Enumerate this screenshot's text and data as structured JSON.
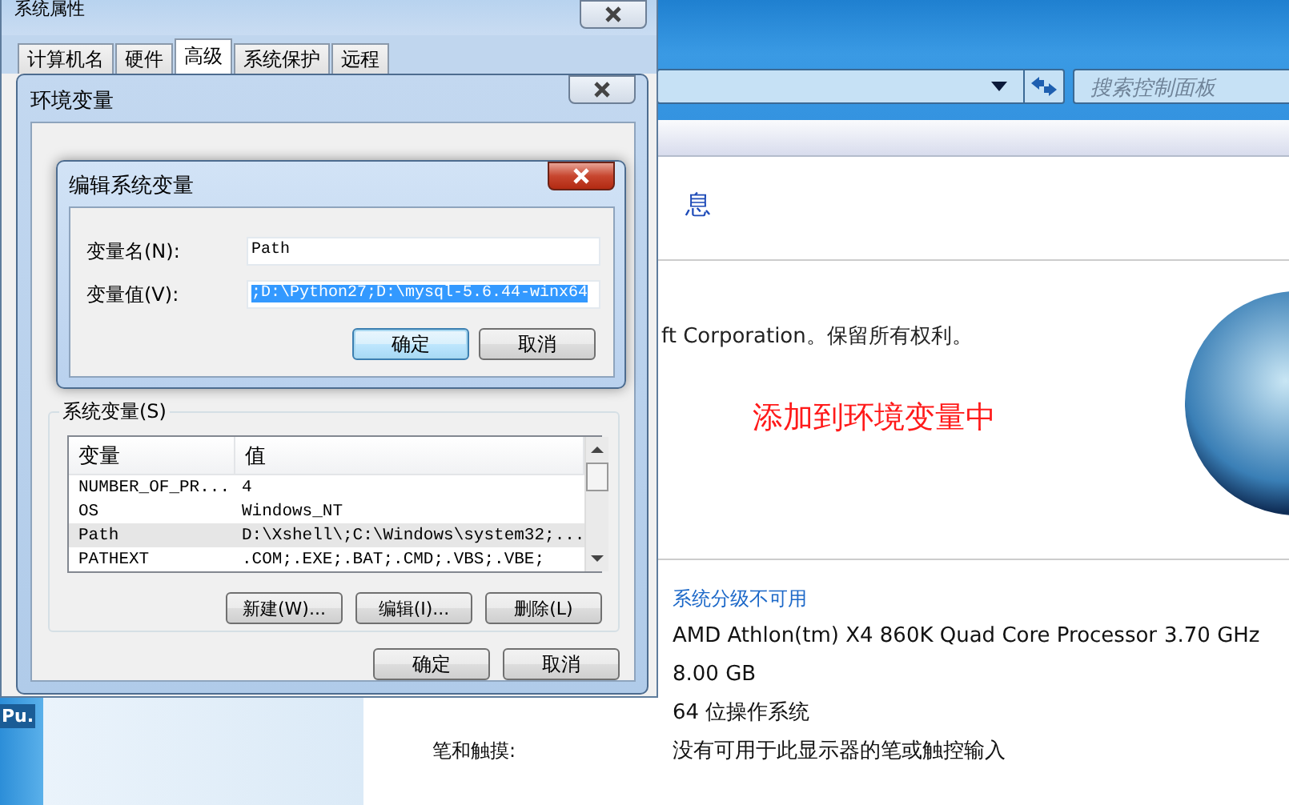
{
  "control_panel": {
    "search": {
      "placeholder": "搜索控制面板"
    },
    "heading": "息",
    "copyright": "ft Corporation。保留所有权利。",
    "annotation": "添加到环境变量中",
    "rating_link": "系统分级不可用",
    "details": [
      {
        "value": "AMD Athlon(tm) X4 860K Quad Core Processor",
        "extra": "3.70 GHz"
      },
      {
        "value": "8.00 GB"
      },
      {
        "value": "64 位操作系统"
      },
      {
        "label": "笔和触摸:",
        "value": "没有可用于此显示器的笔或触控输入"
      }
    ]
  },
  "taskbar_item": "Pu.",
  "system_properties": {
    "title": "系统属性",
    "tabs": [
      {
        "label": "计算机名",
        "selected": false
      },
      {
        "label": "硬件",
        "selected": false
      },
      {
        "label": "高级",
        "selected": true
      },
      {
        "label": "系统保护",
        "selected": false
      },
      {
        "label": "远程",
        "selected": false
      }
    ]
  },
  "environment_dialog": {
    "title": "环境变量",
    "group_label": "系统变量(S)",
    "columns": [
      "变量",
      "值"
    ],
    "rows": [
      {
        "name": "NUMBER_OF_PR...",
        "value": "4",
        "selected": false
      },
      {
        "name": "OS",
        "value": "Windows_NT",
        "selected": false
      },
      {
        "name": "Path",
        "value": "D:\\Xshell\\;C:\\Windows\\system32;...",
        "selected": true
      },
      {
        "name": "PATHEXT",
        "value": ".COM;.EXE;.BAT;.CMD;.VBS;.VBE;",
        "selected": false
      }
    ],
    "row_buttons": [
      "新建(W)...",
      "编辑(I)...",
      "删除(L)"
    ],
    "buttons": [
      "确定",
      "取消"
    ]
  },
  "edit_dialog": {
    "title": "编辑系统变量",
    "fields": [
      {
        "label": "变量名(N):",
        "value": "Path",
        "selected": false
      },
      {
        "label": "变量值(V):",
        "value": ";D:\\Python27;D:\\mysql-5.6.44-winx64",
        "selected": true
      }
    ],
    "buttons": [
      {
        "label": "确定",
        "default": true
      },
      {
        "label": "取消",
        "default": false
      }
    ]
  }
}
